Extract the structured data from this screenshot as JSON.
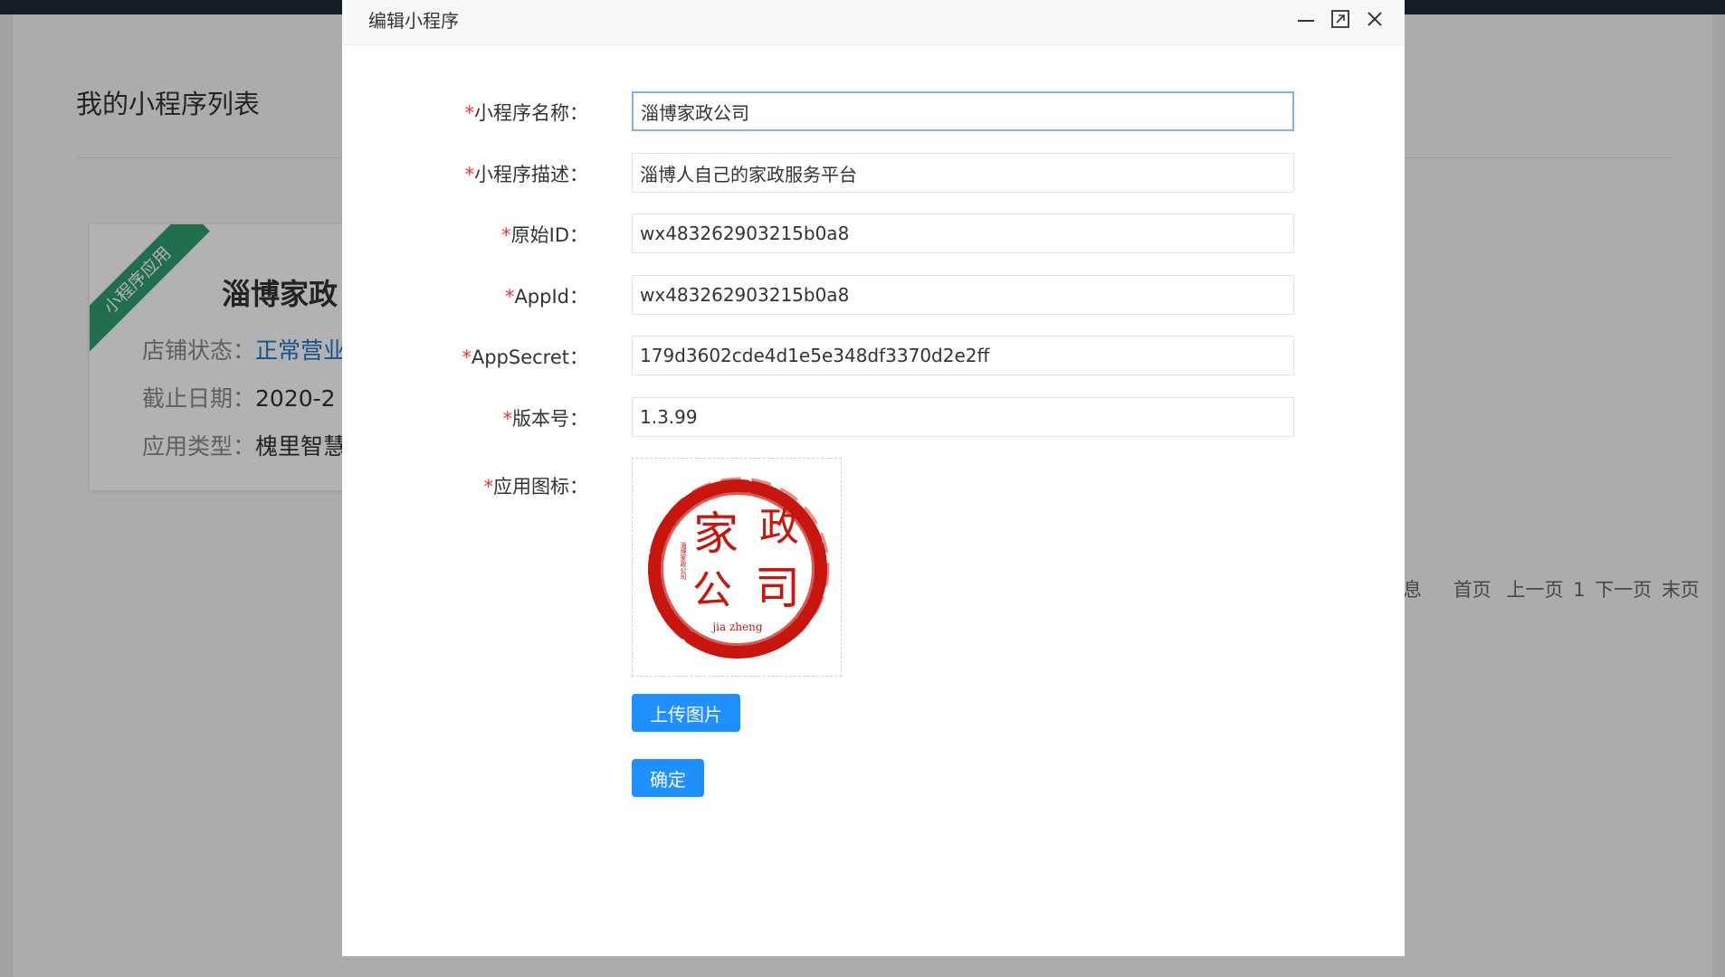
{
  "background": {
    "page_title": "我的小程序列表",
    "card": {
      "ribbon": "小程序应用",
      "name": "淄博家政",
      "status_label": "店铺状态：",
      "status_value": "正常营业",
      "date_label": "截止日期：",
      "date_value": "2020-2",
      "type_label": "应用类型：",
      "type_value": "槐里智慧"
    },
    "pager": {
      "info": "息",
      "first": "首页",
      "prev": "上一页",
      "current": "1",
      "next": "下一页",
      "last": "末页"
    }
  },
  "dialog": {
    "title": "编辑小程序",
    "fields": [
      {
        "label": "小程序名称：",
        "value": "淄博家政公司"
      },
      {
        "label": "小程序描述：",
        "value": "淄博人自己的家政服务平台"
      },
      {
        "label": "原始ID：",
        "value": "wx483262903215b0a8"
      },
      {
        "label": "AppId：",
        "value": "wx483262903215b0a8"
      },
      {
        "label": "AppSecret：",
        "value": "179d3602cde4d1e5e348df3370d2e2ff"
      },
      {
        "label": "版本号：",
        "value": "1.3.99"
      }
    ],
    "required_mark": "*",
    "icon_label": "应用图标：",
    "logo": {
      "line1": "家",
      "line2": "政",
      "line3": "公",
      "line4": "司",
      "small": "淄博家政公司",
      "pinyin": "jia zheng"
    },
    "upload_button": "上传图片",
    "confirm_button": "确定"
  },
  "colors": {
    "accent": "#1e90ff",
    "required": "#ee3333",
    "ribbon": "#2f9e6e",
    "stamp_red": "#c8160e"
  },
  "icons": {
    "minimize": "minimize-icon",
    "maximize": "maximize-icon",
    "close": "close-icon"
  }
}
